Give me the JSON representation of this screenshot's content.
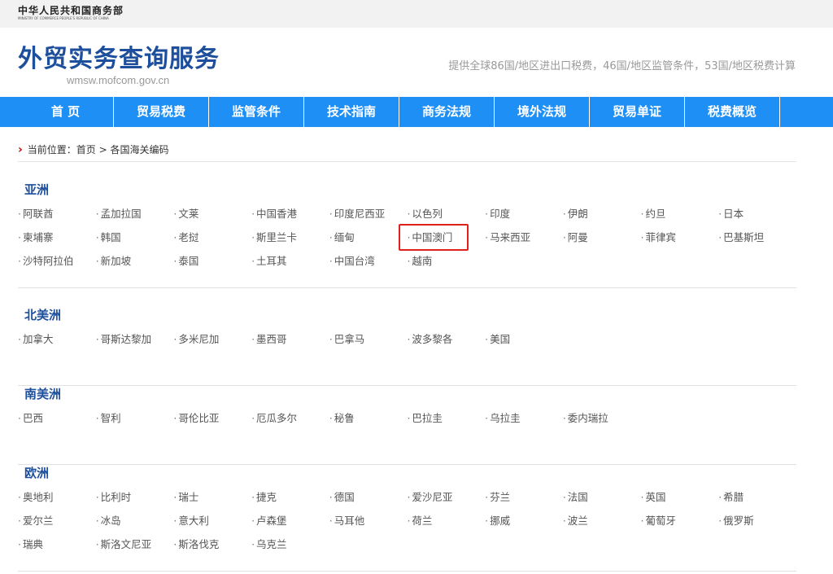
{
  "ministry": {
    "cn": "中华人民共和国商务部",
    "en": "MINISTRY OF COMMERCE PEOPLE'S REPUBLIC OF CHINA"
  },
  "site": {
    "title": "外贸实务查询服务",
    "domain": "wmsw.mofcom.gov.cn",
    "description": "提供全球86国/地区进出口税费，46国/地区监管条件，53国/地区税费计算"
  },
  "nav": [
    "首 页",
    "贸易税费",
    "监管条件",
    "技术指南",
    "商务法规",
    "境外法规",
    "贸易单证",
    "税费概览"
  ],
  "breadcrumb": {
    "prefix": "当前位置：",
    "home": "首页",
    "separator": ">",
    "current": "各国海关编码"
  },
  "regions": [
    {
      "name": "亚洲",
      "countries": [
        "阿联酋",
        "孟加拉国",
        "文莱",
        "中国香港",
        "印度尼西亚",
        "以色列",
        "印度",
        "伊朗",
        "约旦",
        "日本",
        "柬埔寨",
        "韩国",
        "老挝",
        "斯里兰卡",
        "缅甸",
        "中国澳门",
        "马来西亚",
        "阿曼",
        "菲律宾",
        "巴基斯坦",
        "沙特阿拉伯",
        "新加坡",
        "泰国",
        "土耳其",
        "中国台湾",
        "越南"
      ]
    },
    {
      "name": "北美洲",
      "countries": [
        "加拿大",
        "哥斯达黎加",
        "多米尼加",
        "墨西哥",
        "巴拿马",
        "波多黎各",
        "美国"
      ]
    },
    {
      "name": "南美洲",
      "countries": [
        "巴西",
        "智利",
        "哥伦比亚",
        "厄瓜多尔",
        "秘鲁",
        "巴拉圭",
        "乌拉圭",
        "委内瑞拉"
      ]
    },
    {
      "name": "欧洲",
      "countries": [
        "奥地利",
        "比利时",
        "瑞士",
        "捷克",
        "德国",
        "爱沙尼亚",
        "芬兰",
        "法国",
        "英国",
        "希腊",
        "爱尔兰",
        "冰岛",
        "意大利",
        "卢森堡",
        "马耳他",
        "荷兰",
        "挪威",
        "波兰",
        "葡萄牙",
        "俄罗斯",
        "瑞典",
        "斯洛文尼亚",
        "斯洛伐克",
        "乌克兰"
      ]
    }
  ],
  "highlighted_country": "中国澳门",
  "colors": {
    "brand": "#1d4f9c",
    "nav": "#1e8ff5",
    "highlight": "#e0201a"
  }
}
